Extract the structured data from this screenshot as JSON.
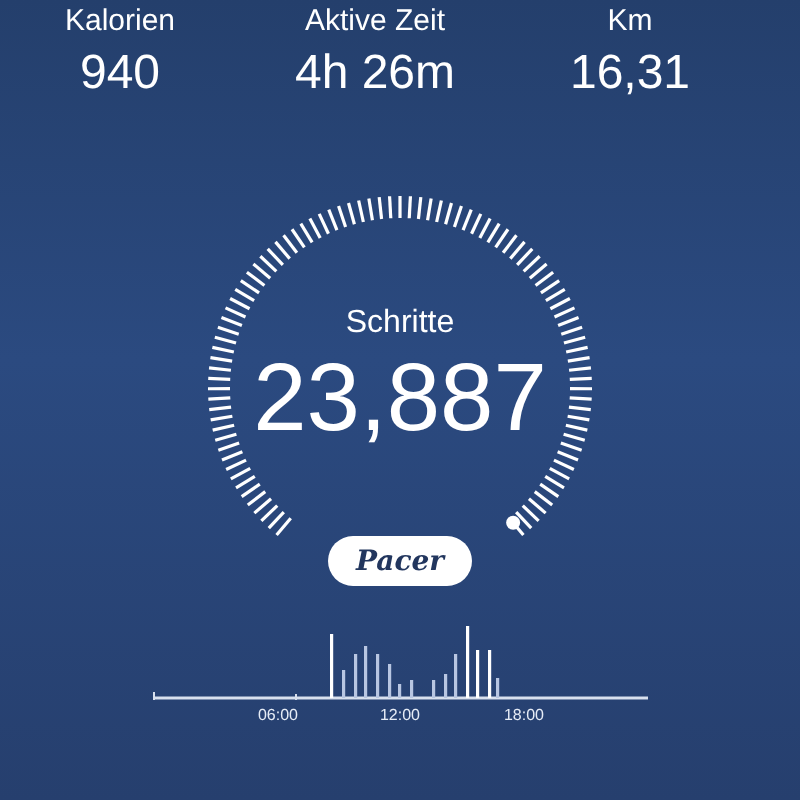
{
  "stats": [
    {
      "label": "Kalorien",
      "value": "940"
    },
    {
      "label": "Aktive Zeit",
      "value": "4h 26m"
    },
    {
      "label": "Km",
      "value": "16,31"
    }
  ],
  "gauge": {
    "label": "Schritte",
    "value": "23,887"
  },
  "brand_button": {
    "label": "Pacer"
  },
  "activity_chart": {
    "axis_labels": [
      "06:00",
      "12:00",
      "18:00"
    ]
  }
}
